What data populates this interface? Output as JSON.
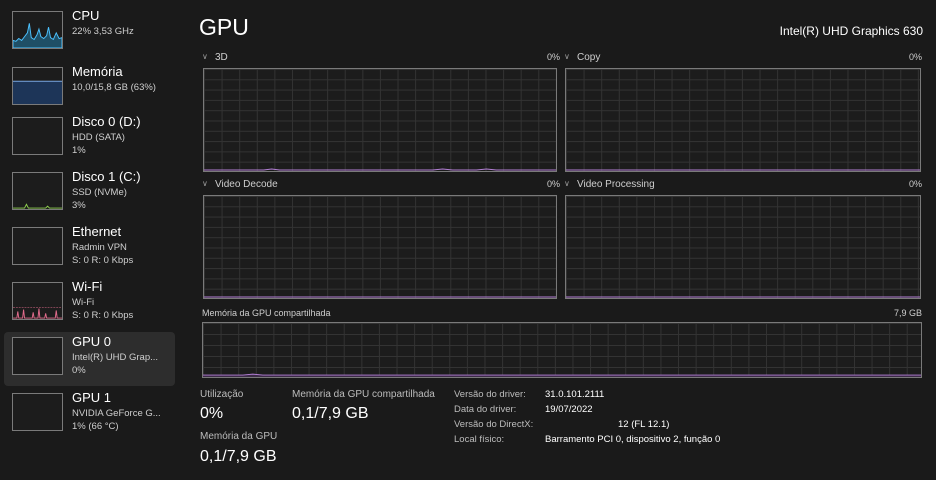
{
  "sidebar": {
    "items": [
      {
        "name": "CPU",
        "line1": "22% 3,53 GHz",
        "line2": "",
        "color": "#4cc2ff",
        "selected": false
      },
      {
        "name": "Memória",
        "line1": "10,0/15,8 GB (63%)",
        "line2": "",
        "color": "#7aa7e0",
        "selected": false
      },
      {
        "name": "Disco 0 (D:)",
        "line1": "HDD (SATA)",
        "line2": "1%",
        "color": "#8fd14f",
        "selected": false
      },
      {
        "name": "Disco 1 (C:)",
        "line1": "SSD (NVMe)",
        "line2": "3%",
        "color": "#8fd14f",
        "selected": false
      },
      {
        "name": "Ethernet",
        "line1": "Radmin VPN",
        "line2": "S: 0 R: 0 Kbps",
        "color": "#d08cdb",
        "selected": false
      },
      {
        "name": "Wi-Fi",
        "line1": "Wi-Fi",
        "line2": "S: 0 R: 0 Kbps",
        "color": "#e06b8b",
        "selected": false
      },
      {
        "name": "GPU 0",
        "line1": "Intel(R) UHD Grap...",
        "line2": "0%",
        "color": "#b480d6",
        "selected": true
      },
      {
        "name": "GPU 1",
        "line1": "NVIDIA GeForce G...",
        "line2": "1% (66 °C)",
        "color": "#b480d6",
        "selected": false
      }
    ]
  },
  "main": {
    "title": "GPU",
    "adapter_name": "Intel(R) UHD Graphics 630",
    "engines": [
      {
        "label": "3D",
        "percent": "0%",
        "color": "#b480d6"
      },
      {
        "label": "Copy",
        "percent": "0%",
        "color": "#b480d6"
      },
      {
        "label": "Video Decode",
        "percent": "0%",
        "color": "#b480d6"
      },
      {
        "label": "Video Processing",
        "percent": "0%",
        "color": "#b480d6"
      }
    ],
    "shared_memory_graph": {
      "label": "Memória da GPU compartilhada",
      "max": "7,9 GB",
      "color": "#b480d6"
    }
  },
  "stats": {
    "utilizacao_label": "Utilização",
    "utilizacao_value": "0%",
    "mem_shared_label": "Memória da GPU compartilhada",
    "mem_shared_value": "0,1/7,9 GB",
    "mem_gpu_label": "Memória da GPU",
    "mem_gpu_value": "0,1/7,9 GB"
  },
  "info": [
    {
      "key": "Versão do driver:",
      "value": "31.0.101.2111"
    },
    {
      "key": "Data do driver:",
      "value": "19/07/2022"
    },
    {
      "key": "Versão do DirectX:",
      "value": "12 (FL 12.1)"
    },
    {
      "key": "Local físico:",
      "value": "Barramento PCI 0, dispositivo 2, função 0"
    }
  ]
}
